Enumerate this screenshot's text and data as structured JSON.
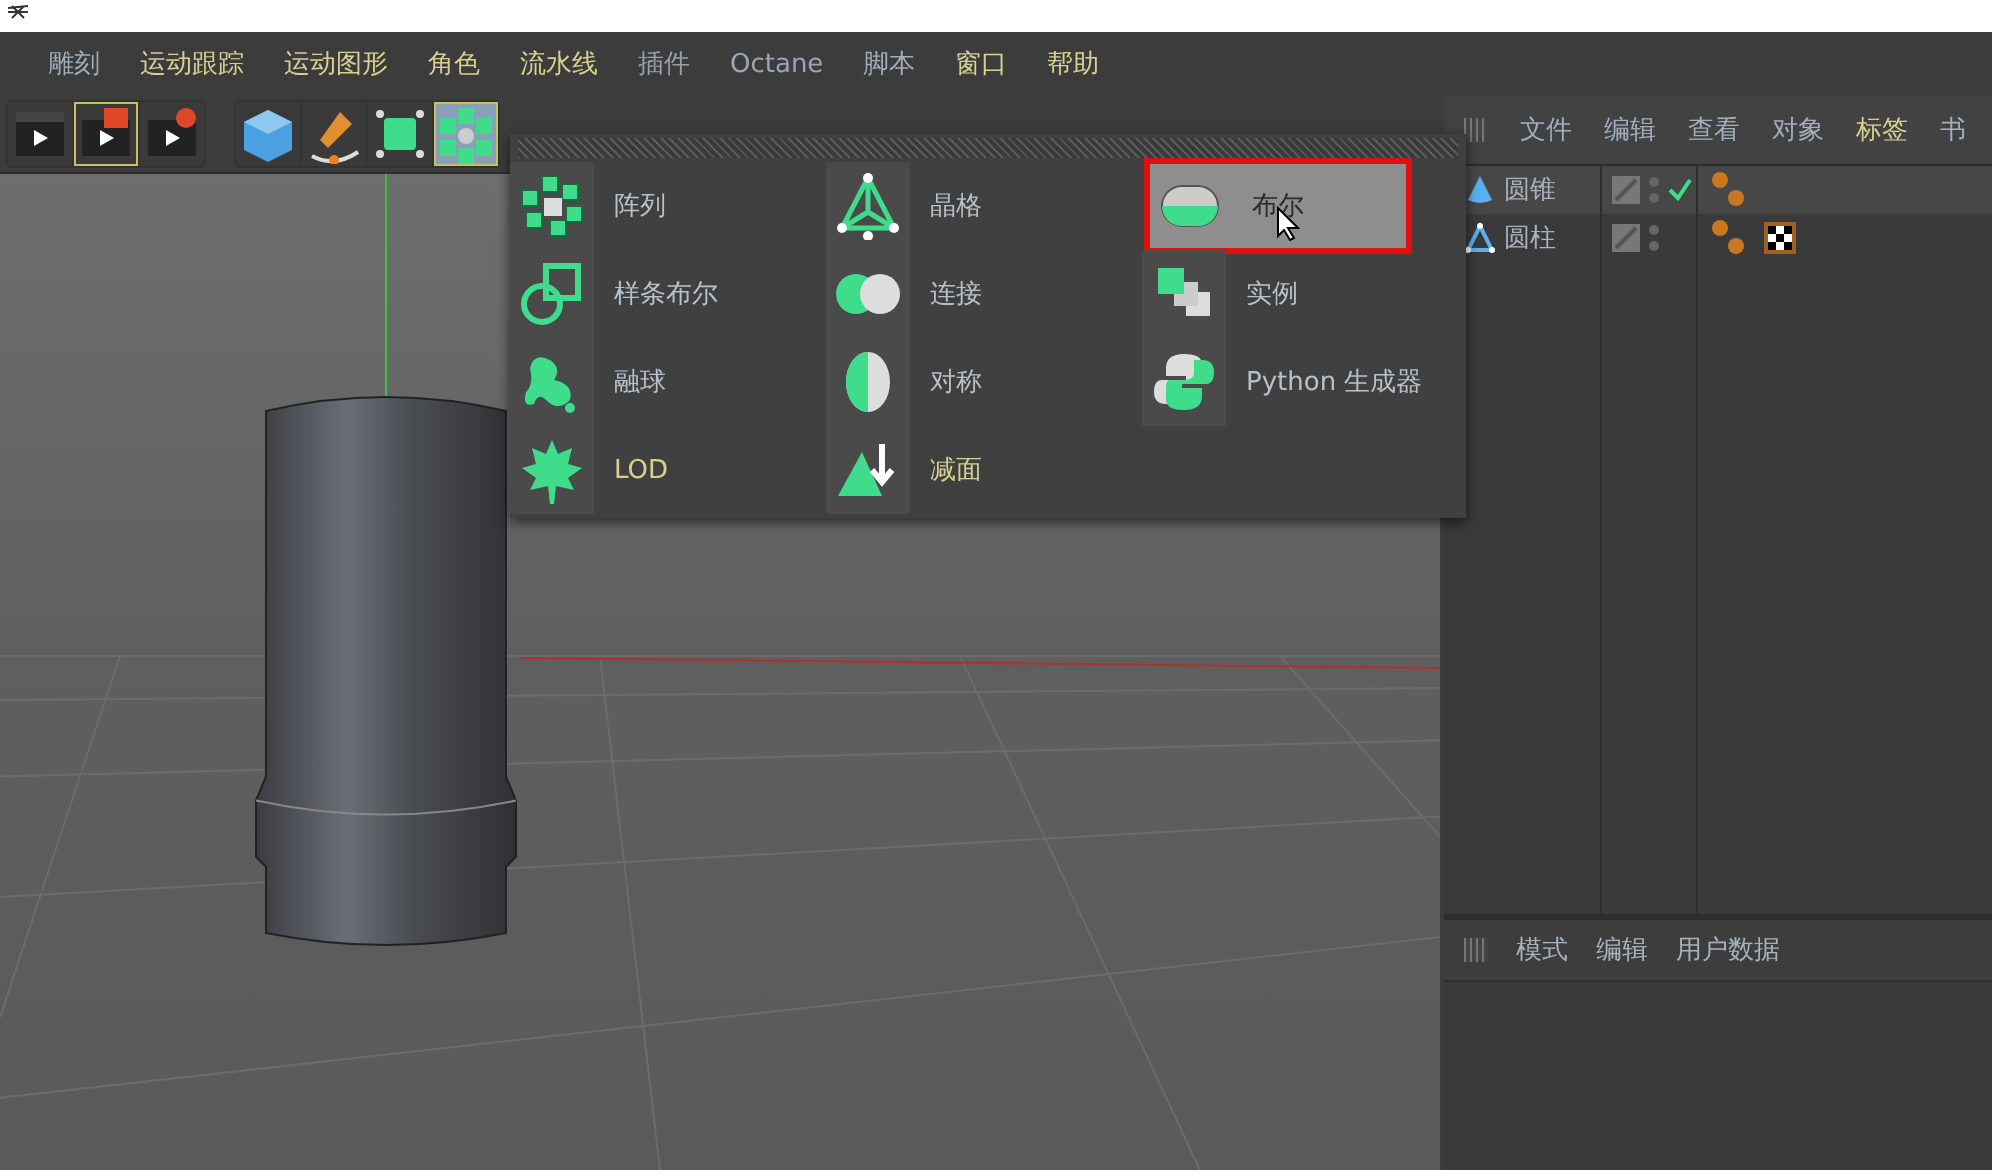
{
  "menu_bar": [
    {
      "label": "雕刻",
      "color": "#a3adbb"
    },
    {
      "label": "运动跟踪",
      "color": "#d6d190"
    },
    {
      "label": "运动图形",
      "color": "#d6d190"
    },
    {
      "label": "角色",
      "color": "#d6d190"
    },
    {
      "label": "流水线",
      "color": "#d6d190"
    },
    {
      "label": "插件",
      "color": "#9aa0a8"
    },
    {
      "label": "Octane",
      "color": "#9aa6b4"
    },
    {
      "label": "脚本",
      "color": "#a3adbb"
    },
    {
      "label": "窗口",
      "color": "#d6d190"
    },
    {
      "label": "帮助",
      "color": "#d6d190"
    }
  ],
  "popup": {
    "columns": [
      [
        {
          "label": "阵列",
          "color": "#b8c0c8",
          "selected": false
        },
        {
          "label": "样条布尔",
          "color": "#b8c0c8",
          "selected": false
        },
        {
          "label": "融球",
          "color": "#b8c0c8",
          "selected": false
        },
        {
          "label": "LOD",
          "color": "#d6d190",
          "selected": false
        }
      ],
      [
        {
          "label": "晶格",
          "color": "#b8c0c8",
          "selected": false
        },
        {
          "label": "连接",
          "color": "#b8c0c8",
          "selected": false
        },
        {
          "label": "对称",
          "color": "#b8c0c8",
          "selected": false
        },
        {
          "label": "减面",
          "color": "#d6d190",
          "selected": false
        }
      ],
      [
        {
          "label": "布尔",
          "color": "#2a2a2a",
          "selected": true
        },
        {
          "label": "实例",
          "color": "#b8c0c8",
          "selected": false
        },
        {
          "label": "Python 生成器",
          "color": "#b8c0c8",
          "selected": false
        }
      ]
    ]
  },
  "object_manager": {
    "tabs": [
      {
        "label": "文件",
        "color": "#a3adbb"
      },
      {
        "label": "编辑",
        "color": "#a3adbb"
      },
      {
        "label": "查看",
        "color": "#a3adbb"
      },
      {
        "label": "对象",
        "color": "#a3adbb"
      },
      {
        "label": "标签",
        "color": "#d6d190"
      },
      {
        "label": "书",
        "color": "#a3adbb"
      }
    ],
    "objects": [
      {
        "name": "圆锥",
        "selected": true,
        "checked": true
      },
      {
        "name": "圆柱",
        "selected": false,
        "checked": false
      }
    ]
  },
  "attributes": {
    "tabs": [
      "模式",
      "编辑",
      "用户数据"
    ]
  }
}
